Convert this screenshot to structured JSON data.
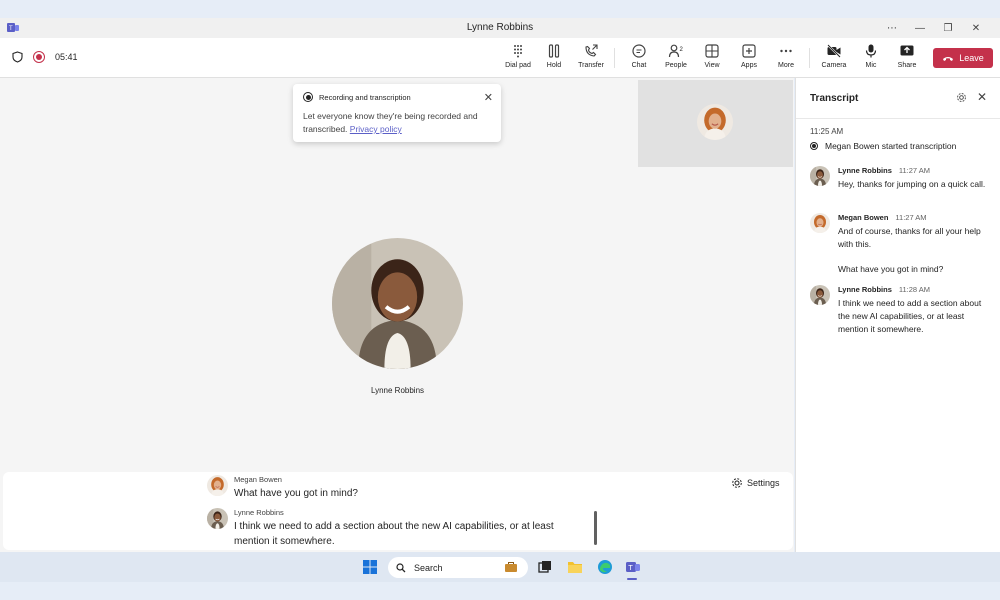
{
  "window": {
    "title": "Lynne Robbins",
    "buttons": [
      "⋯",
      "—",
      "❐",
      "✕"
    ]
  },
  "call": {
    "timer": "05:41"
  },
  "toolbar": {
    "items": [
      {
        "id": "dialpad",
        "label": "Dial pad"
      },
      {
        "id": "hold",
        "label": "Hold"
      },
      {
        "id": "transfer",
        "label": "Transfer"
      },
      {
        "id": "chat",
        "label": "Chat"
      },
      {
        "id": "people",
        "label": "People",
        "count": "2"
      },
      {
        "id": "view",
        "label": "View"
      },
      {
        "id": "apps",
        "label": "Apps"
      },
      {
        "id": "more",
        "label": "More"
      },
      {
        "id": "camera",
        "label": "Camera"
      },
      {
        "id": "mic",
        "label": "Mic"
      },
      {
        "id": "share",
        "label": "Share"
      }
    ],
    "leave_label": "Leave"
  },
  "toast": {
    "title": "Recording and transcription",
    "body": "Let everyone know they're being recorded and transcribed.",
    "link": "Privacy policy"
  },
  "stage": {
    "participant_name": "Lynne Robbins"
  },
  "captions": {
    "settings_label": "Settings",
    "lines": [
      {
        "name": "Megan Bowen",
        "text": "What have you got in mind?"
      },
      {
        "name": "Lynne Robbins",
        "text": "I think we need to add a section about the new AI capabilities, or at least mention it somewhere."
      }
    ]
  },
  "transcript": {
    "title": "Transcript",
    "system_time": "11:25 AM",
    "system_msg": "Megan Bowen started transcription",
    "entries": [
      {
        "name": "Lynne Robbins",
        "time": "11:27 AM",
        "text": "Hey, thanks for jumping on a quick call."
      },
      {
        "name": "Megan Bowen",
        "time": "11:27 AM",
        "text": "And of course, thanks for all your help with this."
      },
      {
        "name": "Lynne Robbins",
        "time": "11:28 AM",
        "text": "I think we need to add a section about the new AI capabilities, or at least mention it somewhere."
      }
    ],
    "continuation": "What have you got in mind?"
  },
  "taskbar": {
    "search_placeholder": "Search"
  },
  "colors": {
    "accent": "#5b5fc7",
    "leave": "#c4314b",
    "recording": "#c4314b"
  }
}
